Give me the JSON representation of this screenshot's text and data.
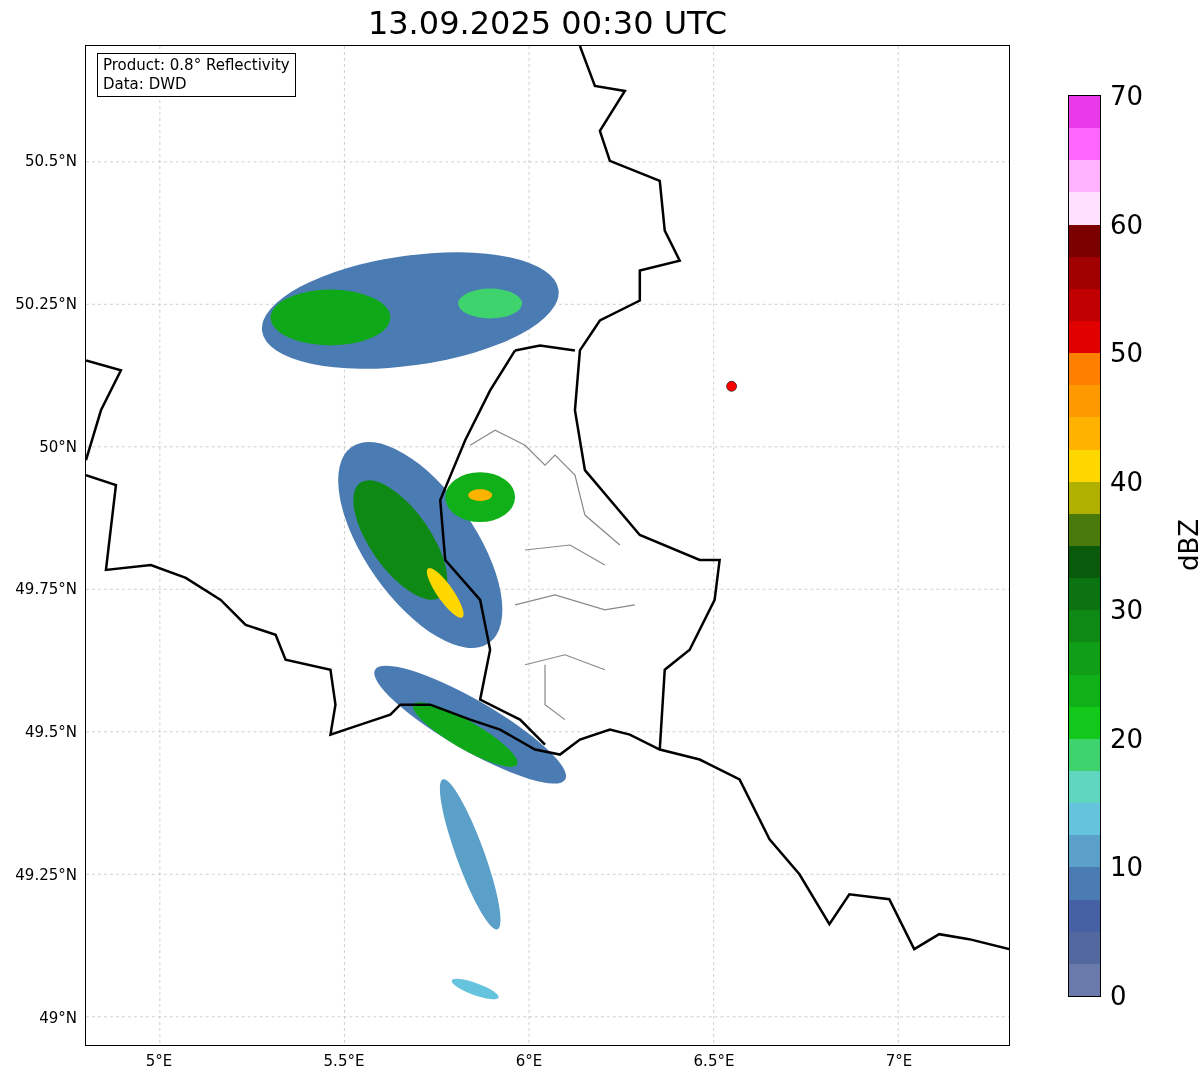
{
  "title": "13.09.2025 00:30 UTC",
  "legend": {
    "lines": [
      "Product: 0.8° Reflectivity",
      "Data: DWD"
    ]
  },
  "map": {
    "yticks": [
      "50.5°N",
      "50.25°N",
      "50°N",
      "49.75°N",
      "49.5°N",
      "49.25°N",
      "49°N"
    ],
    "xticks": [
      "5°E",
      "5.5°E",
      "6°E",
      "6.5°E",
      "7°E"
    ]
  },
  "colorbar": {
    "label": "dBZ",
    "ticks": [
      "70",
      "60",
      "50",
      "40",
      "30",
      "20",
      "10",
      "0"
    ],
    "bands": [
      {
        "color": "#e83ae8"
      },
      {
        "color": "#ff66ff"
      },
      {
        "color": "#ffb3ff"
      },
      {
        "color": "#ffe0ff"
      },
      {
        "color": "#7a0000"
      },
      {
        "color": "#a00000"
      },
      {
        "color": "#c00000"
      },
      {
        "color": "#e00000"
      },
      {
        "color": "#ff7f00"
      },
      {
        "color": "#ff9900"
      },
      {
        "color": "#ffb300"
      },
      {
        "color": "#ffd700"
      },
      {
        "color": "#b0b000"
      },
      {
        "color": "#4a7a0c"
      },
      {
        "color": "#0a5a0c"
      },
      {
        "color": "#0b7410"
      },
      {
        "color": "#0e8a14"
      },
      {
        "color": "#0f9e16"
      },
      {
        "color": "#10b018"
      },
      {
        "color": "#12c81a"
      },
      {
        "color": "#3ed36c"
      },
      {
        "color": "#60d6c1"
      },
      {
        "color": "#66c3de"
      },
      {
        "color": "#5ba0c8"
      },
      {
        "color": "#4b7bb3"
      },
      {
        "color": "#4561a3"
      },
      {
        "color": "#5468a0"
      },
      {
        "color": "#6a7aaa"
      }
    ]
  }
}
